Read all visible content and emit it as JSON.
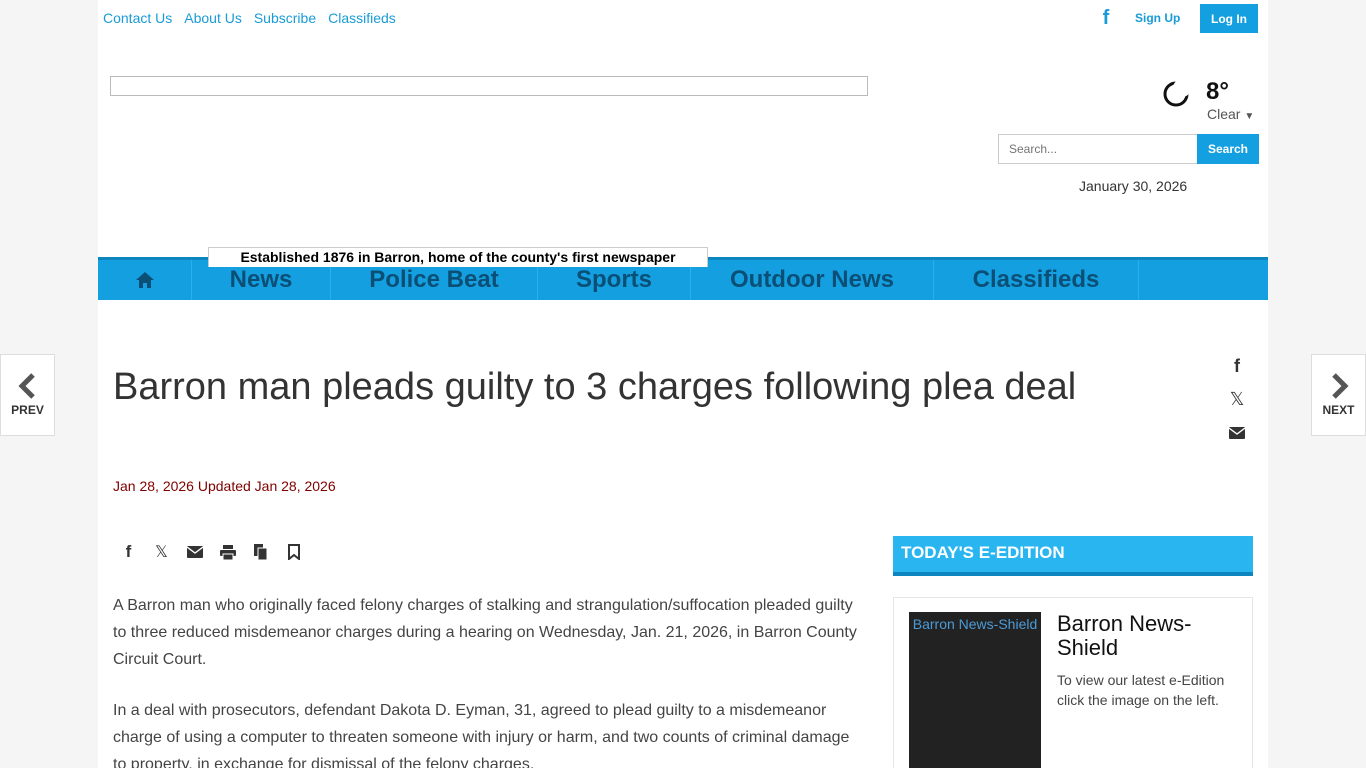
{
  "topbar": {
    "links": [
      "Contact Us",
      "About Us",
      "Subscribe",
      "Classifieds"
    ],
    "signup": "Sign Up",
    "login": "Log In"
  },
  "weather": {
    "temp": "8°",
    "condition": "Clear"
  },
  "search": {
    "placeholder": "Search...",
    "button": "Search"
  },
  "date": "January 30, 2026",
  "tagline": "Established 1876 in Barron, home of the county's first newspaper",
  "nav": [
    "News",
    "Police Beat",
    "Sports",
    "Outdoor News",
    "Classifieds"
  ],
  "article": {
    "headline": "Barron man pleads guilty to 3 charges following plea deal",
    "dateline": "Jan 28, 2026 Updated Jan 28, 2026",
    "paragraphs": [
      "A Barron man who originally faced felony charges of stalking and strangulation/suffocation pleaded guilty to three reduced misdemeanor charges during a hearing on Wednesday, Jan. 21, 2026, in Barron County Circuit Court.",
      "In a deal with prosecutors, defendant Dakota D. Eyman, 31, agreed to plead guilty to a misdemeanor charge of using a computer to threaten someone with injury or harm, and two counts of criminal damage to property, in exchange for dismissal of the felony charges."
    ]
  },
  "eedition": {
    "header": "TODAY'S E-EDITION",
    "img_alt": "Barron News-Shield",
    "title": "Barron News-Shield",
    "desc": "To view our latest e-Edition click the image on the left."
  },
  "pager": {
    "prev": "PREV",
    "next": "NEXT"
  },
  "colors": {
    "accent": "#14a0e0",
    "nav_text": "#0b4f76",
    "dateline": "#800000"
  }
}
